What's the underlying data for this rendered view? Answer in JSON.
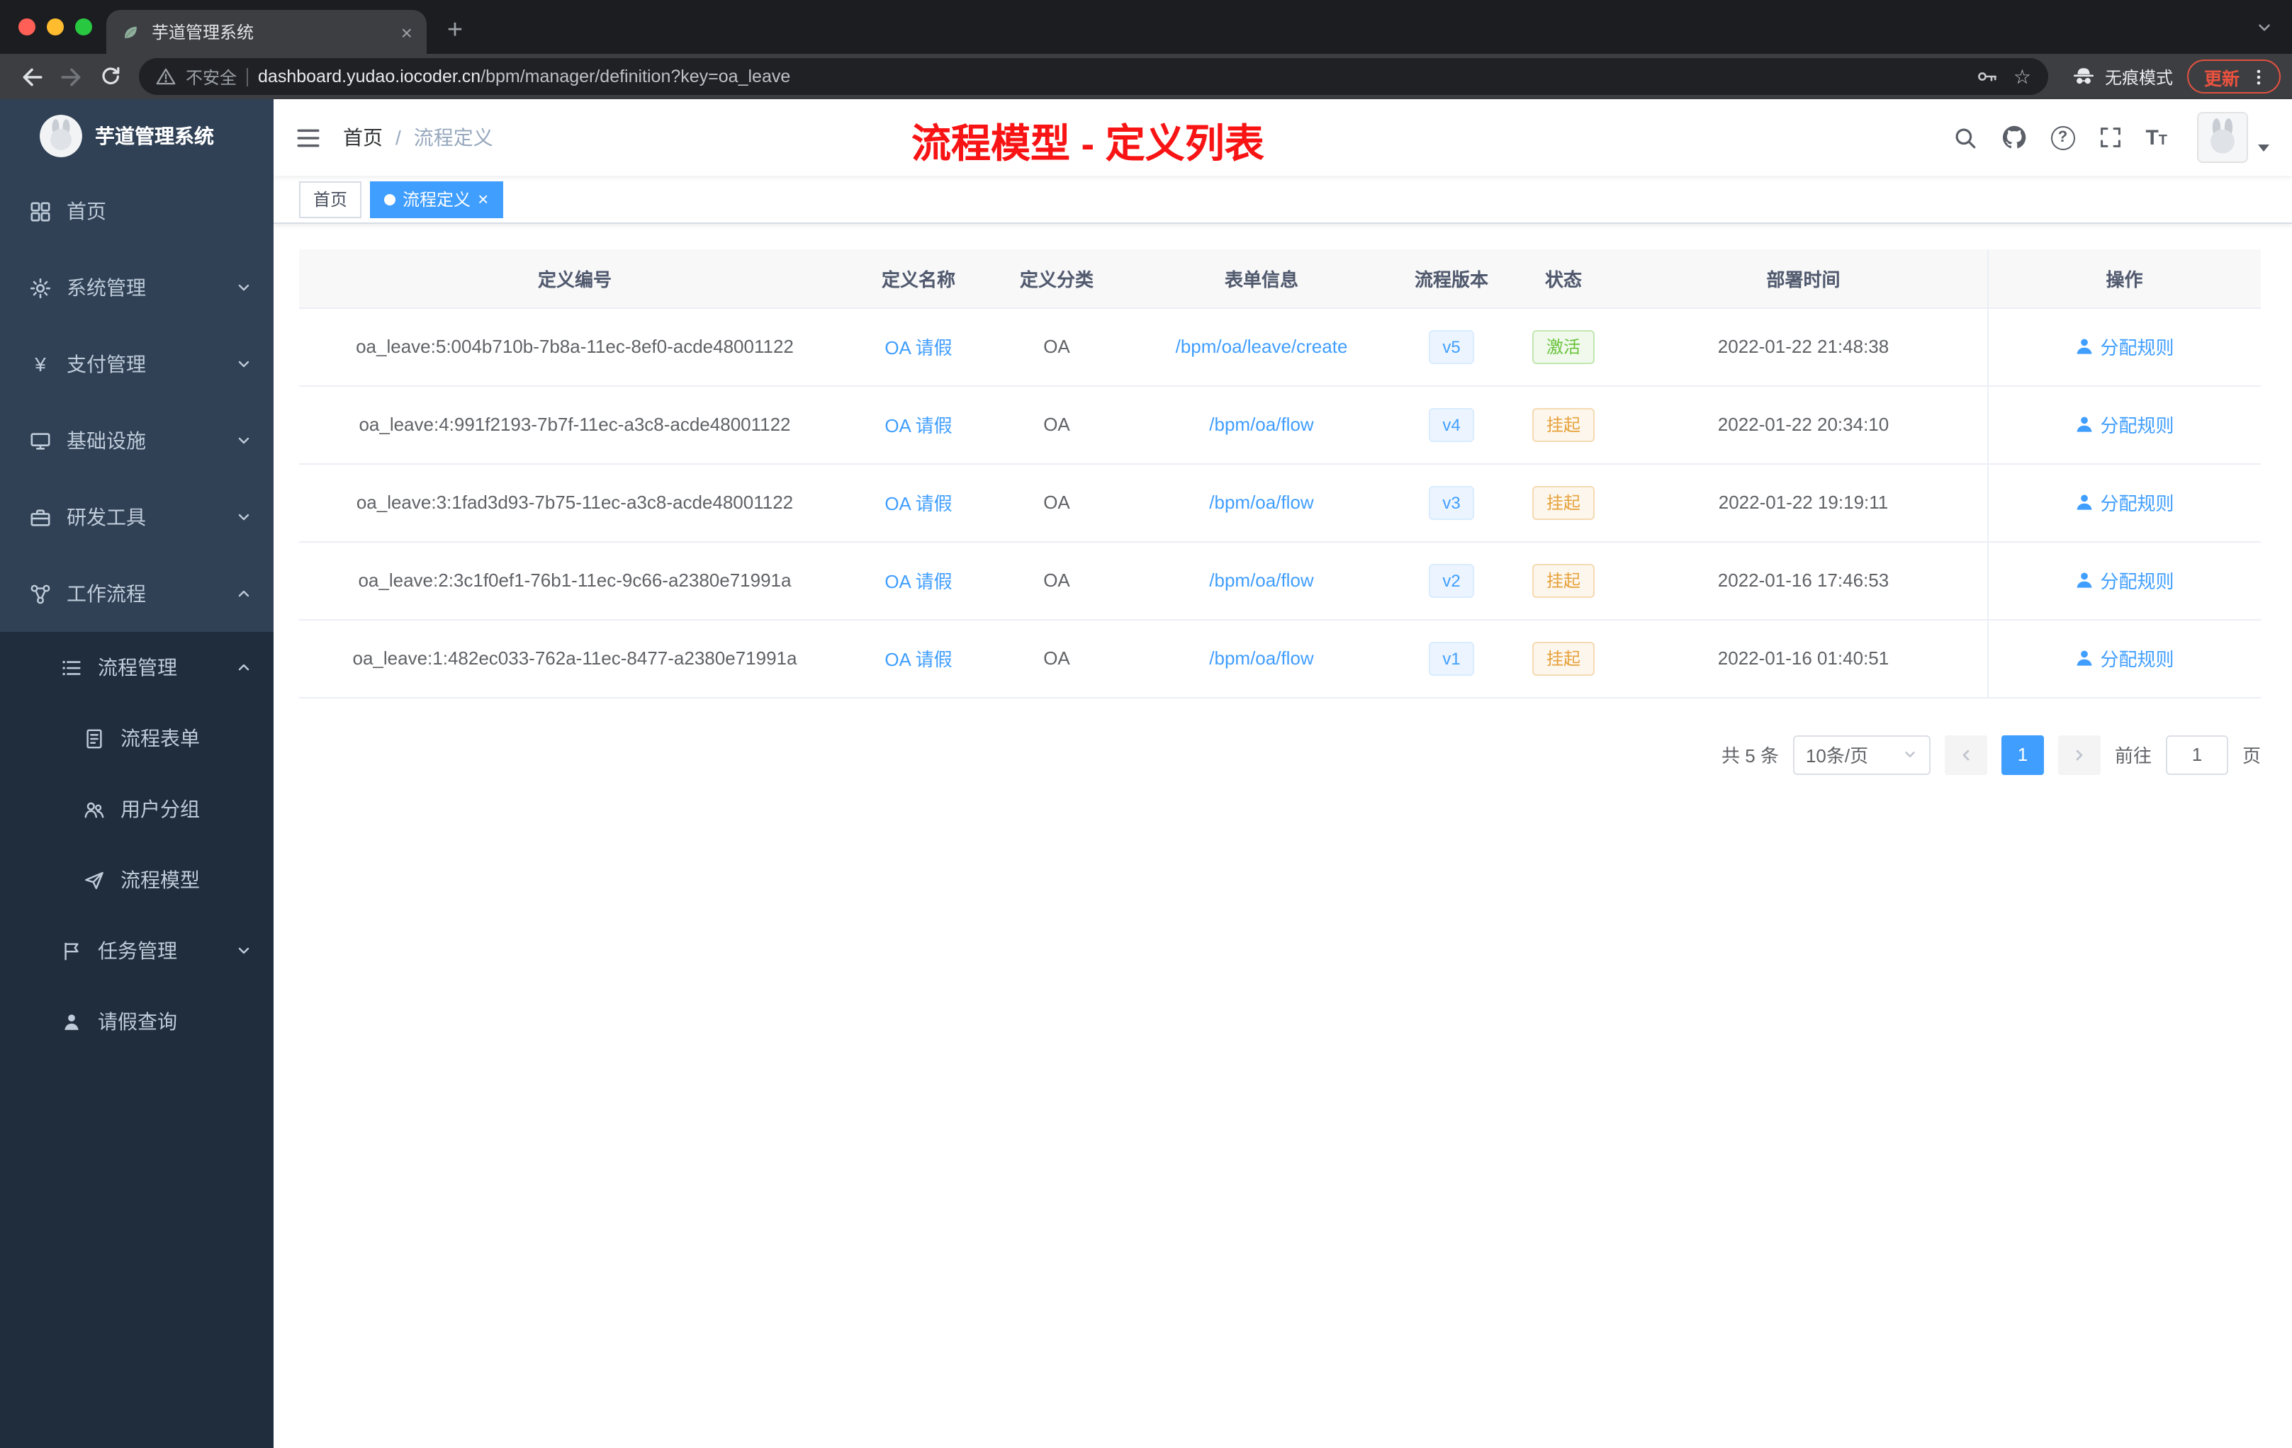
{
  "browser": {
    "tab_title": "芋道管理系统",
    "new_tab_label": "+",
    "security_label": "不安全",
    "url_host": "dashboard.yudao.iocoder.cn",
    "url_path": "/bpm/manager/definition?key=oa_leave",
    "incognito_label": "无痕模式",
    "update_label": "更新"
  },
  "sidebar": {
    "logo_title": "芋道管理系统",
    "items": [
      {
        "label": "首页"
      },
      {
        "label": "系统管理"
      },
      {
        "label": "支付管理"
      },
      {
        "label": "基础设施"
      },
      {
        "label": "研发工具"
      },
      {
        "label": "工作流程"
      },
      {
        "label": "流程管理"
      },
      {
        "label": "流程表单"
      },
      {
        "label": "用户分组"
      },
      {
        "label": "流程模型"
      },
      {
        "label": "任务管理"
      },
      {
        "label": "请假查询"
      }
    ]
  },
  "header": {
    "breadcrumb_home": "首页",
    "breadcrumb_sep": "/",
    "breadcrumb_current": "流程定义",
    "annotation": "流程模型 - 定义列表"
  },
  "tags": {
    "home": "首页",
    "current": "流程定义",
    "close": "×"
  },
  "table": {
    "columns": [
      "定义编号",
      "定义名称",
      "定义分类",
      "表单信息",
      "流程版本",
      "状态",
      "部署时间",
      "操作"
    ],
    "rows": [
      {
        "id": "oa_leave:5:004b710b-7b8a-11ec-8ef0-acde48001122",
        "name": "OA 请假",
        "category": "OA",
        "form": "/bpm/oa/leave/create",
        "version": "v5",
        "status": "激活",
        "status_type": "success",
        "time": "2022-01-22 21:48:38",
        "action": "分配规则"
      },
      {
        "id": "oa_leave:4:991f2193-7b7f-11ec-a3c8-acde48001122",
        "name": "OA 请假",
        "category": "OA",
        "form": "/bpm/oa/flow",
        "version": "v4",
        "status": "挂起",
        "status_type": "warning",
        "time": "2022-01-22 20:34:10",
        "action": "分配规则"
      },
      {
        "id": "oa_leave:3:1fad3d93-7b75-11ec-a3c8-acde48001122",
        "name": "OA 请假",
        "category": "OA",
        "form": "/bpm/oa/flow",
        "version": "v3",
        "status": "挂起",
        "status_type": "warning",
        "time": "2022-01-22 19:19:11",
        "action": "分配规则"
      },
      {
        "id": "oa_leave:2:3c1f0ef1-76b1-11ec-9c66-a2380e71991a",
        "name": "OA 请假",
        "category": "OA",
        "form": "/bpm/oa/flow",
        "version": "v2",
        "status": "挂起",
        "status_type": "warning",
        "time": "2022-01-16 17:46:53",
        "action": "分配规则"
      },
      {
        "id": "oa_leave:1:482ec033-762a-11ec-8477-a2380e71991a",
        "name": "OA 请假",
        "category": "OA",
        "form": "/bpm/oa/flow",
        "version": "v1",
        "status": "挂起",
        "status_type": "warning",
        "time": "2022-01-16 01:40:51",
        "action": "分配规则"
      }
    ]
  },
  "pagination": {
    "total": "共 5 条",
    "page_size": "10条/页",
    "current_page": "1",
    "goto_label": "前往",
    "goto_value": "1",
    "goto_unit": "页"
  },
  "colors": {
    "accent": "#409eff",
    "success_text": "#67c23a",
    "warning_text": "#e6a23c",
    "annotation_red": "#f81414",
    "sidebar_bg": "#304156",
    "sidebar_sub_bg": "#1f2d3d"
  }
}
